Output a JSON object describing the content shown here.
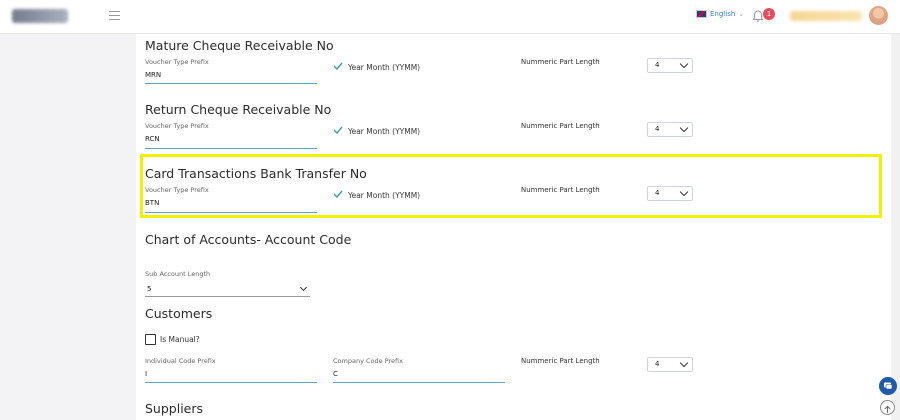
{
  "header": {
    "language": "English",
    "notification_count": "1"
  },
  "sections": [
    {
      "title": "Mature Cheque Receivable No",
      "prefix_label": "Voucher Type Prefix",
      "prefix_value": "MRN",
      "year_month_label": "Year Month (YYMM)",
      "numeric_label": "Nummeric Part Length",
      "numeric_value": "4"
    },
    {
      "title": "Return Cheque Receivable No",
      "prefix_label": "Voucher Type Prefix",
      "prefix_value": "RCN",
      "year_month_label": "Year Month (YYMM)",
      "numeric_label": "Nummeric Part Length",
      "numeric_value": "4"
    },
    {
      "title": "Card Transactions Bank Transfer No",
      "prefix_label": "Voucher Type Prefix",
      "prefix_value": "BTN",
      "year_month_label": "Year Month (YYMM)",
      "numeric_label": "Nummeric Part Length",
      "numeric_value": "4"
    }
  ],
  "chart_of_accounts": {
    "title": "Chart of Accounts- Account Code",
    "sub_account_label": "Sub Account Length",
    "sub_account_value": "5"
  },
  "customers": {
    "title": "Customers",
    "is_manual_label": "Is Manual?",
    "individual_label": "Individual Code Prefix",
    "individual_value": "I",
    "company_label": "Company Code Prefix",
    "company_value": "C",
    "numeric_label": "Nummeric Part Length",
    "numeric_value": "4"
  },
  "suppliers": {
    "title": "Suppliers"
  },
  "colors": {
    "accent": "#5aa7c9",
    "highlight": "#f2f200",
    "check": "#3aa3a8",
    "badge": "#e74c5a"
  }
}
